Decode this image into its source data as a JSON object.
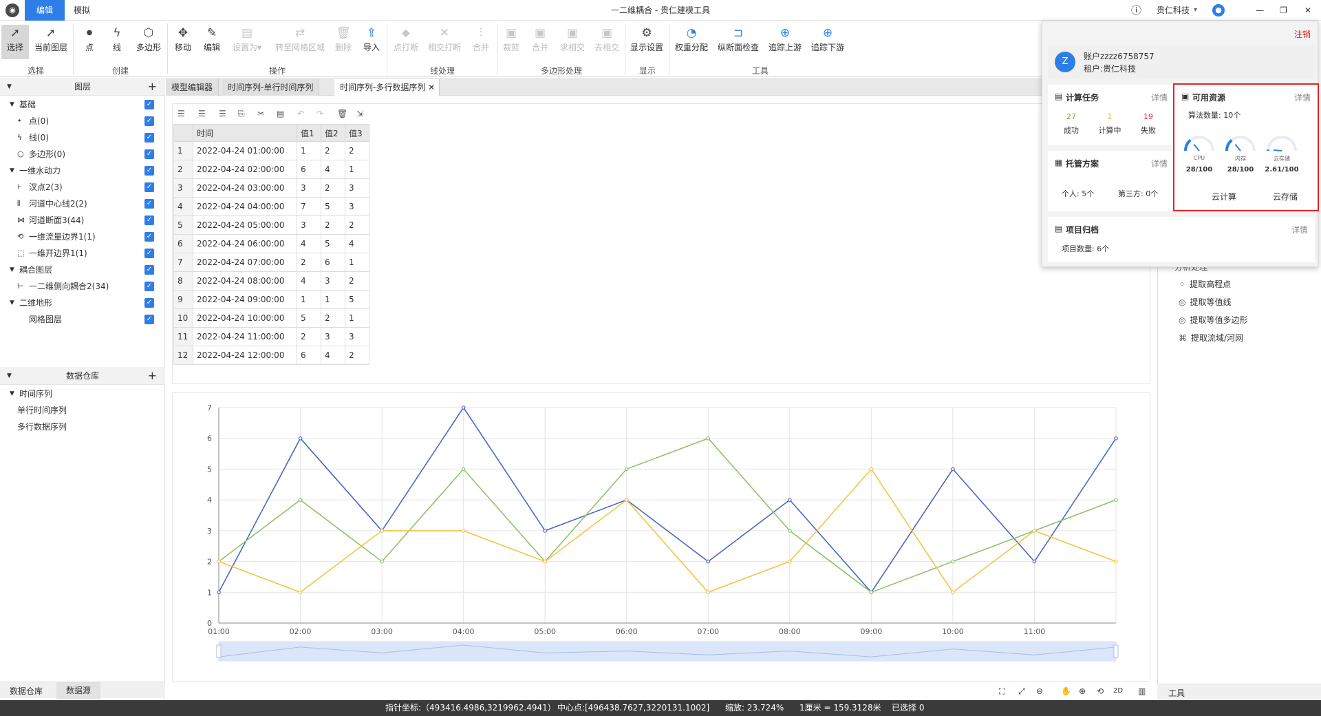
{
  "titlebar": {
    "logo_icon": "app-logo-icon",
    "tabs": [
      "编辑",
      "模拟"
    ],
    "title": "一二维耦合 - 贵仁建模工具",
    "company": "贵仁科技",
    "company_caret": "▾",
    "win_min": "—",
    "win_max": "❐",
    "win_close": "✕"
  },
  "ribbon": {
    "buttons": [
      {
        "label": "选择",
        "icon": "➚"
      },
      {
        "label": "当前图层",
        "icon": "➚"
      },
      {
        "label": "点",
        "icon": "●"
      },
      {
        "label": "线",
        "icon": "ϟ"
      },
      {
        "label": "多边形",
        "icon": "⬡"
      },
      {
        "label": "移动",
        "icon": "✥"
      },
      {
        "label": "编辑",
        "icon": "✎"
      },
      {
        "label": "设置为",
        "icon": "▤"
      },
      {
        "label": "转至网格区域",
        "icon": "⇄"
      },
      {
        "label": "删除",
        "icon": "🗑"
      },
      {
        "label": "导入",
        "icon": "⇪"
      },
      {
        "label": "点打断",
        "icon": "⬥"
      },
      {
        "label": "相交打断",
        "icon": "✕"
      },
      {
        "label": "合并",
        "icon": "⫶"
      },
      {
        "label": "裁剪",
        "icon": "▣"
      },
      {
        "label": "合并",
        "icon": "▣"
      },
      {
        "label": "求相交",
        "icon": "▣"
      },
      {
        "label": "去相交",
        "icon": "▣"
      },
      {
        "label": "显示设置",
        "icon": "⚙"
      },
      {
        "label": "权重分配",
        "icon": "◔"
      },
      {
        "label": "纵断面检查",
        "icon": "⊐"
      },
      {
        "label": "追踪上游",
        "icon": "⊕"
      },
      {
        "label": "追踪下游",
        "icon": "⊕"
      }
    ],
    "groups": [
      "选择",
      "创建",
      "操作",
      "线处理",
      "多边形处理",
      "显示",
      "工具"
    ],
    "setas_caret": "▾"
  },
  "layers": {
    "title": "图层",
    "collapse_icon": "▼",
    "add": "+",
    "check": "✓",
    "items": [
      {
        "label": "基础",
        "icon": "▼"
      },
      {
        "label": "点(0)",
        "icon": "•"
      },
      {
        "label": "线(0)",
        "icon": "ϟ"
      },
      {
        "label": "多边形(0)",
        "icon": "○"
      },
      {
        "label": "一维水动力",
        "icon": "▼"
      },
      {
        "label": "汊点2(3)",
        "icon": "⊦"
      },
      {
        "label": "河道中心线2(2)",
        "icon": "⫴"
      },
      {
        "label": "河道断面3(44)",
        "icon": "⋈"
      },
      {
        "label": "一维流量边界1(1)",
        "icon": "⟲"
      },
      {
        "label": "一维开边界1(1)",
        "icon": "⬚"
      },
      {
        "label": "耦合图层",
        "icon": "▼"
      },
      {
        "label": "一二维侧向耦合2(34)",
        "icon": "⊢"
      },
      {
        "label": "二维地形",
        "icon": "▼"
      },
      {
        "label": "网格图层",
        "icon": ""
      }
    ]
  },
  "warehouse": {
    "title": "数据仓库",
    "collapse_icon": "▼",
    "add": "+",
    "items": [
      {
        "label": "时间序列",
        "icon": "▼"
      },
      {
        "label": "单行时间序列",
        "icon": ""
      },
      {
        "label": "多行数据序列",
        "icon": ""
      }
    ],
    "bottom_tabs": [
      "数据仓库",
      "数据源"
    ]
  },
  "doc_tabs": [
    "模型编辑器",
    "时间序列-单行时间序列",
    "时间序列-多行数据序列"
  ],
  "doc_tab_close": "✕",
  "table": {
    "toolbar_icons": [
      "☰",
      "☰",
      "☰",
      "⎘",
      "✂",
      "▤",
      "↶",
      "↷",
      "🗑",
      "⇲"
    ],
    "headers": [
      "",
      "时间",
      "值1",
      "值2",
      "值3"
    ],
    "rows": [
      [
        "1",
        "2022-04-24 01:00:00",
        "1",
        "2",
        "2"
      ],
      [
        "2",
        "2022-04-24 02:00:00",
        "6",
        "4",
        "1"
      ],
      [
        "3",
        "2022-04-24 03:00:00",
        "3",
        "2",
        "3"
      ],
      [
        "4",
        "2022-04-24 04:00:00",
        "7",
        "5",
        "3"
      ],
      [
        "5",
        "2022-04-24 05:00:00",
        "3",
        "2",
        "2"
      ],
      [
        "6",
        "2022-04-24 06:00:00",
        "4",
        "5",
        "4"
      ],
      [
        "7",
        "2022-04-24 07:00:00",
        "2",
        "6",
        "1"
      ],
      [
        "8",
        "2022-04-24 08:00:00",
        "4",
        "3",
        "2"
      ],
      [
        "9",
        "2022-04-24 09:00:00",
        "1",
        "1",
        "5"
      ],
      [
        "10",
        "2022-04-24 10:00:00",
        "5",
        "2",
        "1"
      ],
      [
        "11",
        "2022-04-24 11:00:00",
        "2",
        "3",
        "3"
      ],
      [
        "12",
        "2022-04-24 12:00:00",
        "6",
        "4",
        "2"
      ]
    ]
  },
  "chart_data": {
    "type": "line",
    "x": [
      "01:00",
      "02:00",
      "03:00",
      "04:00",
      "05:00",
      "06:00",
      "07:00",
      "08:00",
      "09:00",
      "10:00",
      "11:00",
      "12:00"
    ],
    "xticks": [
      "01:00",
      "02:00",
      "03:00",
      "04:00",
      "05:00",
      "06:00",
      "07:00",
      "08:00",
      "09:00",
      "10:00",
      "11:00"
    ],
    "ylim": [
      0,
      7
    ],
    "yticks": [
      "0",
      "1",
      "2",
      "3",
      "4",
      "5",
      "6",
      "7"
    ],
    "grid": true,
    "series": [
      {
        "color": "#4a68c2",
        "values": [
          1,
          6,
          3,
          7,
          3,
          4,
          2,
          4,
          1,
          5,
          2,
          6
        ]
      },
      {
        "color": "#8cc468",
        "values": [
          2,
          4,
          2,
          5,
          2,
          5,
          6,
          3,
          1,
          2,
          3,
          4
        ]
      },
      {
        "color": "#f6c343",
        "values": [
          2,
          1,
          3,
          3,
          2,
          4,
          1,
          2,
          5,
          1,
          3,
          2
        ]
      }
    ],
    "zoom_window": [
      0,
      1
    ]
  },
  "right_tools": {
    "title": "工具",
    "section_title": "分析处理",
    "items": [
      {
        "label": "提取高程点",
        "icon": "⁘"
      },
      {
        "label": "提取等值线",
        "icon": "◎"
      },
      {
        "label": "提取等值多边形",
        "icon": "◎"
      },
      {
        "label": "提取流域/河网",
        "icon": "⌘"
      }
    ]
  },
  "map_toolbar_icons": [
    "⛶",
    "⤢",
    "⊖",
    "✋",
    "⊕",
    "⟲",
    "2D",
    "▥"
  ],
  "statusbar": {
    "pointer": "指针坐标:（493416.4986,3219962.4941）",
    "center": "中心点:[496438.7627,3220131.1002]",
    "zoom": "缩放: 23.724%",
    "scale": "1厘米 = 159.3128米",
    "selected": "已选择 0"
  },
  "popup": {
    "logout": "注销",
    "avatar_letter": "Z",
    "account": "账户zzzz6758757",
    "tenant": "租户:贵仁科技",
    "tasks": {
      "title": "计算任务",
      "icon": "▤",
      "detail": "详情",
      "stats": [
        {
          "value": "27",
          "label": "成功",
          "color": "#52c41a"
        },
        {
          "value": "1",
          "label": "计算中",
          "color": "#faad14"
        },
        {
          "value": "19",
          "label": "失败",
          "color": "#f5222d"
        }
      ]
    },
    "resources": {
      "title": "可用资源",
      "icon": "▣",
      "detail": "详情",
      "algo": "算法数量: 10个",
      "gauges": [
        {
          "label": "CPU",
          "value": "28/100",
          "fraction": 0.28
        },
        {
          "label": "内存",
          "value": "28/100",
          "fraction": 0.28
        },
        {
          "label": "云存储",
          "value": "2.61/100",
          "fraction": 0.0261
        }
      ],
      "footers": [
        "云计算",
        "云存储"
      ]
    },
    "hosting": {
      "title": "托管方案",
      "icon": "▦",
      "detail": "详情",
      "personal": "个人: 5个",
      "third": "第三方: 0个"
    },
    "projects": {
      "title": "项目归档",
      "icon": "▤",
      "detail": "详情",
      "count": "项目数量: 6个"
    }
  }
}
